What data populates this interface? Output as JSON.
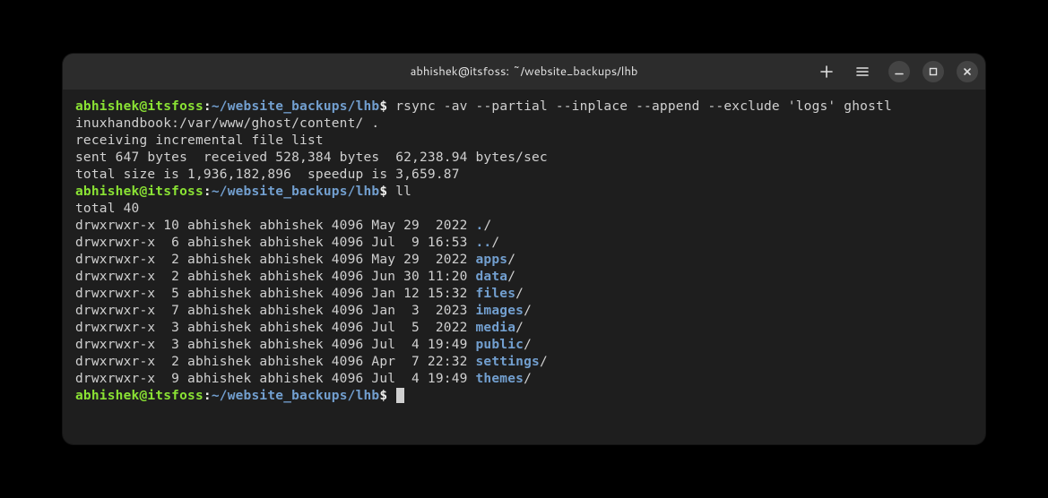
{
  "window": {
    "title": "abhishek@itsfoss: ~/website_backups/lhb"
  },
  "prompt": {
    "user_host": "abhishek@itsfoss",
    "sep": ":",
    "path": "~/website_backups/lhb",
    "dollar": "$"
  },
  "commands": {
    "rsync": " rsync -av --partial --inplace --append --exclude 'logs' ghostl",
    "rsync_wrap": "inuxhandbook:/var/www/ghost/content/ .",
    "ll": " ll"
  },
  "output": {
    "recv": "receiving incremental file list",
    "blank": "",
    "sent": "sent 647 bytes  received 528,384 bytes  62,238.94 bytes/sec",
    "total_size": "total size is 1,936,182,896  speedup is 3,659.87",
    "total": "total 40"
  },
  "listing": [
    {
      "stat": "drwxrwxr-x 10 abhishek abhishek 4096 May 29  2022 ",
      "name": ".",
      "suffix": "/"
    },
    {
      "stat": "drwxrwxr-x  6 abhishek abhishek 4096 Jul  9 16:53 ",
      "name": "..",
      "suffix": "/"
    },
    {
      "stat": "drwxrwxr-x  2 abhishek abhishek 4096 May 29  2022 ",
      "name": "apps",
      "suffix": "/"
    },
    {
      "stat": "drwxrwxr-x  2 abhishek abhishek 4096 Jun 30 11:20 ",
      "name": "data",
      "suffix": "/"
    },
    {
      "stat": "drwxrwxr-x  5 abhishek abhishek 4096 Jan 12 15:32 ",
      "name": "files",
      "suffix": "/"
    },
    {
      "stat": "drwxrwxr-x  7 abhishek abhishek 4096 Jan  3  2023 ",
      "name": "images",
      "suffix": "/"
    },
    {
      "stat": "drwxrwxr-x  3 abhishek abhishek 4096 Jul  5  2022 ",
      "name": "media",
      "suffix": "/"
    },
    {
      "stat": "drwxrwxr-x  3 abhishek abhishek 4096 Jul  4 19:49 ",
      "name": "public",
      "suffix": "/"
    },
    {
      "stat": "drwxrwxr-x  2 abhishek abhishek 4096 Apr  7 22:32 ",
      "name": "settings",
      "suffix": "/"
    },
    {
      "stat": "drwxrwxr-x  9 abhishek abhishek 4096 Jul  4 19:49 ",
      "name": "themes",
      "suffix": "/"
    }
  ]
}
